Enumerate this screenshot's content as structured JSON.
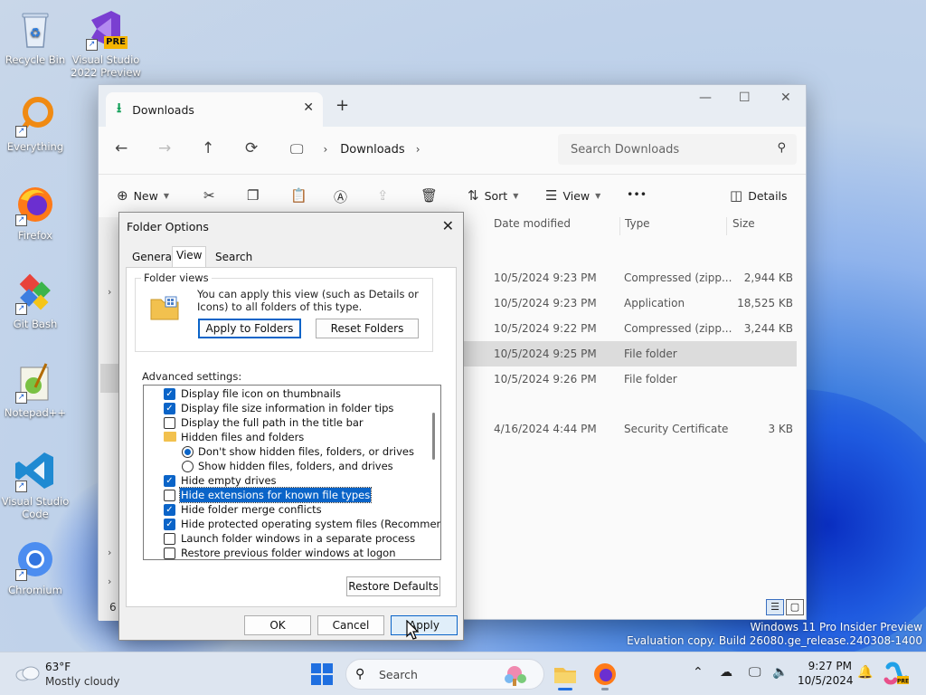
{
  "desktop": {
    "icons": [
      {
        "label": "Recycle Bin"
      },
      {
        "label": "Visual Studio 2022 Preview",
        "badge": "PRE"
      },
      {
        "label": "Everything"
      },
      {
        "label": "Firefox"
      },
      {
        "label": "Git Bash"
      },
      {
        "label": "Notepad++"
      },
      {
        "label": "Visual Studio Code"
      },
      {
        "label": "Chromium"
      }
    ]
  },
  "explorer": {
    "tab_title": "Downloads",
    "breadcrumb": "Downloads",
    "search_placeholder": "Search Downloads",
    "commands": {
      "new": "New",
      "sort": "Sort",
      "view": "View",
      "more": "•••",
      "details": "Details"
    },
    "columns": {
      "date_modified": "Date modified",
      "type": "Type",
      "size": "Size"
    },
    "rows": [
      {
        "date": "10/5/2024 9:23 PM",
        "type": "Compressed (zipp...",
        "size": "2,944 KB"
      },
      {
        "date": "10/5/2024 9:23 PM",
        "type": "Application",
        "size": "18,525 KB"
      },
      {
        "date": "10/5/2024 9:22 PM",
        "type": "Compressed (zipp...",
        "size": "3,244 KB"
      },
      {
        "date": "10/5/2024 9:25 PM",
        "type": "File folder",
        "size": ""
      },
      {
        "date": "10/5/2024 9:26 PM",
        "type": "File folder",
        "size": ""
      },
      {
        "date": "4/16/2024 4:44 PM",
        "type": "Security Certificate",
        "size": "3 KB"
      }
    ],
    "status_count": "6"
  },
  "dialog": {
    "title": "Folder Options",
    "tabs": [
      "General",
      "View",
      "Search"
    ],
    "folder_views": {
      "label": "Folder views",
      "text": "You can apply this view (such as Details or Icons) to all folders of this type.",
      "apply_button": "Apply to Folders",
      "reset_button": "Reset Folders"
    },
    "advanced_label": "Advanced settings:",
    "settings": [
      {
        "kind": "checkbox",
        "checked": true,
        "label": "Display file icon on thumbnails"
      },
      {
        "kind": "checkbox",
        "checked": true,
        "label": "Display file size information in folder tips"
      },
      {
        "kind": "checkbox",
        "checked": false,
        "label": "Display the full path in the title bar"
      },
      {
        "kind": "folder",
        "label": "Hidden files and folders"
      },
      {
        "kind": "radio",
        "checked": true,
        "label": "Don't show hidden files, folders, or drives"
      },
      {
        "kind": "radio",
        "checked": false,
        "label": "Show hidden files, folders, and drives"
      },
      {
        "kind": "checkbox",
        "checked": true,
        "label": "Hide empty drives"
      },
      {
        "kind": "checkbox",
        "checked": false,
        "label": "Hide extensions for known file types",
        "highlighted": true
      },
      {
        "kind": "checkbox",
        "checked": true,
        "label": "Hide folder merge conflicts"
      },
      {
        "kind": "checkbox",
        "checked": true,
        "label": "Hide protected operating system files (Recommended)"
      },
      {
        "kind": "checkbox",
        "checked": false,
        "label": "Launch folder windows in a separate process"
      },
      {
        "kind": "checkbox",
        "checked": false,
        "label": "Restore previous folder windows at logon"
      }
    ],
    "restore_defaults": "Restore Defaults",
    "ok": "OK",
    "cancel": "Cancel",
    "apply": "Apply"
  },
  "watermark": {
    "line1": "Windows 11 Pro Insider Preview",
    "line2": "Evaluation copy. Build 26080.ge_release.240308-1400"
  },
  "taskbar": {
    "weather_temp": "63°F",
    "weather_desc": "Mostly cloudy",
    "search_label": "Search",
    "time": "9:27 PM",
    "date": "10/5/2024"
  },
  "colors": {
    "accent": "#0a64c8",
    "download_green": "#14a05a",
    "start_blue": "#1f6fe0"
  }
}
